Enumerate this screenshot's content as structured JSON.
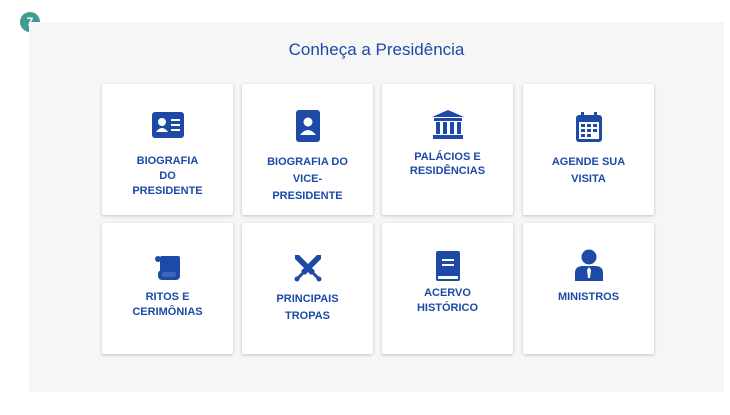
{
  "step_badge": "7",
  "section_title": "Conheça a Presidência",
  "accent_color": "#1c4aa6",
  "cards": [
    {
      "label_lines": [
        "BIOGRAFIA",
        "DO",
        "PRESIDENTE"
      ],
      "icon": "id-card-icon"
    },
    {
      "label_lines": [
        "BIOGRAFIA DO",
        "VICE-",
        "PRESIDENTE"
      ],
      "icon": "person-badge-icon"
    },
    {
      "label_lines": [
        "PALÁCIOS E",
        "RESIDÊNCIAS"
      ],
      "icon": "building-icon"
    },
    {
      "label_lines": [
        "AGENDE SUA",
        "VISITA"
      ],
      "icon": "calendar-icon"
    },
    {
      "label_lines": [
        "RITOS E",
        "CERIMÔNIAS"
      ],
      "icon": "scroll-icon"
    },
    {
      "label_lines": [
        "PRINCIPAIS",
        "TROPAS"
      ],
      "icon": "crossed-swords-icon"
    },
    {
      "label_lines": [
        "ACERVO",
        "HISTÓRICO"
      ],
      "icon": "book-icon"
    },
    {
      "label_lines": [
        "MINISTROS"
      ],
      "icon": "user-tie-icon"
    }
  ]
}
